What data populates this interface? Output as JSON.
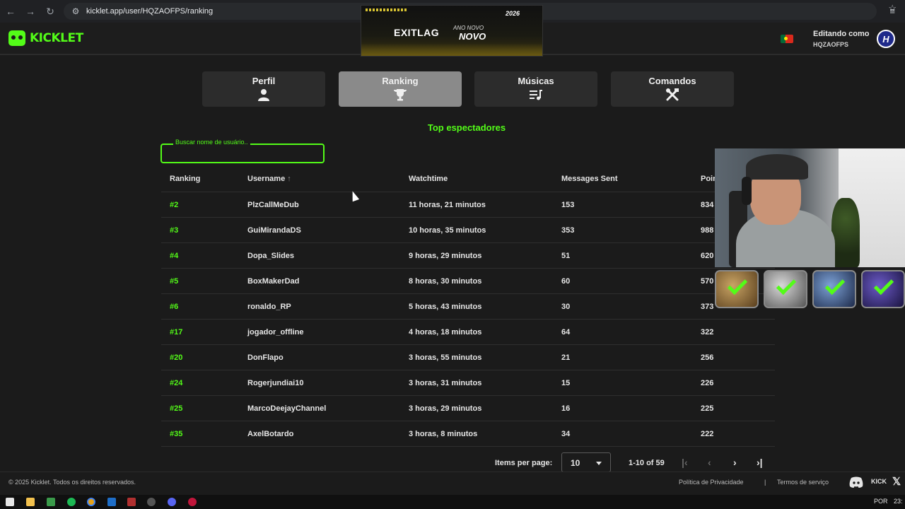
{
  "browser": {
    "url": "kicklet.app/user/HQZAOFPS/ranking"
  },
  "header": {
    "logo_text": "KICKLET",
    "editing_title": "Editando como",
    "editing_user": "HQZAOFPS",
    "avatar_letter": "H"
  },
  "ad": {
    "brand": "EXITLAG",
    "line1": "ANO NOVO",
    "line2": "NOVO",
    "year": "2026"
  },
  "tabs": [
    {
      "label": "Perfil",
      "icon": "person-icon",
      "active": false
    },
    {
      "label": "Ranking",
      "icon": "trophy-icon",
      "active": true
    },
    {
      "label": "Músicas",
      "icon": "playlist-icon",
      "active": false
    },
    {
      "label": "Comandos",
      "icon": "tools-icon",
      "active": false
    }
  ],
  "section_title": "Top espectadores",
  "search": {
    "placeholder": "Buscar nome de usuário..",
    "value": ""
  },
  "table": {
    "headers": [
      "Ranking",
      "Username",
      "Watchtime",
      "Messages Sent",
      "Poin"
    ],
    "sort_column": "Username",
    "rows": [
      {
        "rank": "#2",
        "username": "PlzCallMeDub",
        "watchtime": "11 horas, 21 minutos",
        "messages": "153",
        "points": "834"
      },
      {
        "rank": "#3",
        "username": "GuiMirandaDS",
        "watchtime": "10 horas, 35 minutos",
        "messages": "353",
        "points": "988"
      },
      {
        "rank": "#4",
        "username": "Dopa_Slides",
        "watchtime": "9 horas, 29 minutos",
        "messages": "51",
        "points": "620"
      },
      {
        "rank": "#5",
        "username": "BoxMakerDad",
        "watchtime": "8 horas, 30 minutos",
        "messages": "60",
        "points": "570"
      },
      {
        "rank": "#6",
        "username": "ronaldo_RP",
        "watchtime": "5 horas, 43 minutos",
        "messages": "30",
        "points": "373"
      },
      {
        "rank": "#17",
        "username": "jogador_offline",
        "watchtime": "4 horas, 18 minutos",
        "messages": "64",
        "points": "322"
      },
      {
        "rank": "#20",
        "username": "DonFlapo",
        "watchtime": "3 horas, 55 minutos",
        "messages": "21",
        "points": "256"
      },
      {
        "rank": "#24",
        "username": "Rogerjundiai10",
        "watchtime": "3 horas, 31 minutos",
        "messages": "15",
        "points": "226"
      },
      {
        "rank": "#25",
        "username": "MarcoDeejayChannel",
        "watchtime": "3 horas, 29 minutos",
        "messages": "16",
        "points": "225"
      },
      {
        "rank": "#35",
        "username": "AxelBotardo",
        "watchtime": "3 horas, 8 minutos",
        "messages": "34",
        "points": "222"
      }
    ]
  },
  "pagination": {
    "items_label": "Items per page:",
    "per_page": "10",
    "range": "1-10 of 59"
  },
  "footer": {
    "copyright": "© 2025 Kicklet. Todos os direitos reservados.",
    "privacy": "Política de Privacidade",
    "separator": "|",
    "terms": "Termos de serviço",
    "kick": "KICK"
  },
  "taskbar": {
    "lang": "POR",
    "clock": "23:"
  },
  "colors": {
    "accent": "#53fc18",
    "background": "#1b1b1b",
    "tab_active": "#8a8a8a",
    "tab_inactive": "#2c2c2c"
  }
}
